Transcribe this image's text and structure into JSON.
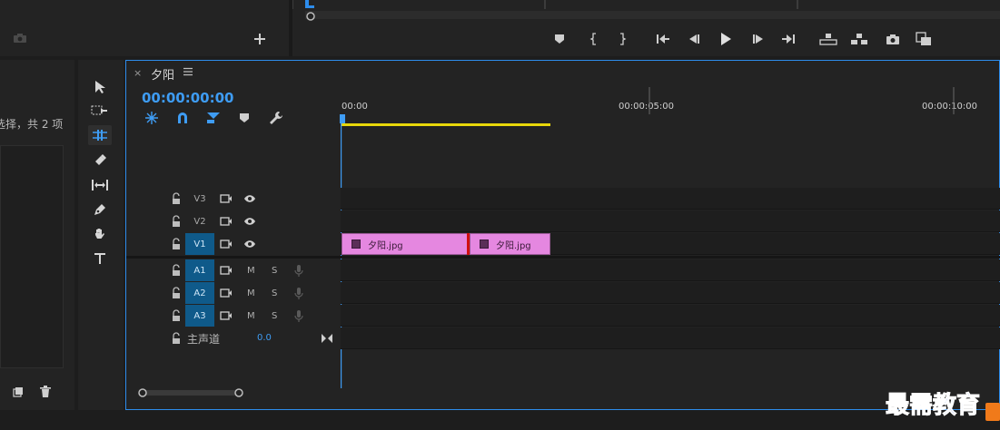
{
  "monitor": {
    "transport_buttons": [
      "marker",
      "in",
      "out",
      "go-to-in",
      "step-back",
      "play",
      "step-forward",
      "go-to-out",
      "lift",
      "extract",
      "export-frame",
      "compare"
    ]
  },
  "project": {
    "selection_text": "选择，共 2 项"
  },
  "timeline": {
    "sequence_name": "夕阳",
    "timecode": "00:00:00:00",
    "ruler": [
      "00:00",
      "00:00:05:00",
      "00:00:10:00"
    ],
    "video_tracks": [
      {
        "name": "V3",
        "active": false
      },
      {
        "name": "V2",
        "active": false
      },
      {
        "name": "V1",
        "active": true
      }
    ],
    "audio_tracks": [
      {
        "name": "A1",
        "m": "M",
        "s": "S"
      },
      {
        "name": "A2",
        "m": "M",
        "s": "S"
      },
      {
        "name": "A3",
        "m": "M",
        "s": "S"
      }
    ],
    "master": {
      "label": "主声道",
      "value": "0.0"
    },
    "clips": [
      {
        "name": "夕阳.jpg"
      },
      {
        "name": "夕阳.jpg"
      }
    ]
  },
  "watermark": "最需教育",
  "colors": {
    "accent": "#2d8ceb",
    "clip": "#e587e0",
    "active_track": "#0f5a8a",
    "work_area": "#e8d70a"
  }
}
